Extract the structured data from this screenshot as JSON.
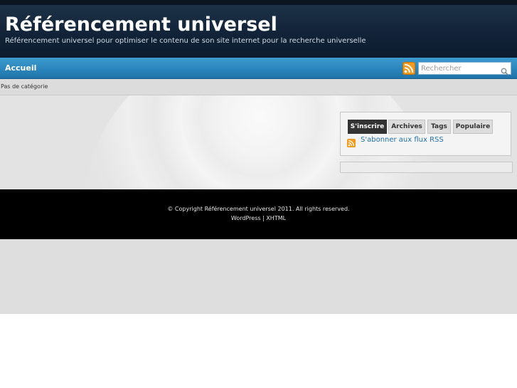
{
  "header": {
    "title": "Référencement universel",
    "description": "Référencement universel pour optimiser le contenu de son site internet pour la recherche universelle"
  },
  "nav": {
    "home_label": "Accueil",
    "rss_icon": "rss-icon",
    "search": {
      "placeholder": "Rechercher",
      "icon": "search-icon"
    }
  },
  "breadcrumb": {
    "text": "Pas de catégorie"
  },
  "sidebar": {
    "tabs": [
      {
        "label": "S'inscrire",
        "active": true
      },
      {
        "label": "Archives",
        "active": false
      },
      {
        "label": "Tags",
        "active": false
      },
      {
        "label": "Populaire",
        "active": false
      }
    ],
    "feed_link": "S'abonner aux flux RSS"
  },
  "footer": {
    "copyright": "© Copyright Référencement universel 2011. All rights reserved.",
    "link_wordpress": "WordPress",
    "separator": "|",
    "link_xhtml": "XHTML"
  },
  "colors": {
    "header_bg": "#112237",
    "nav_bg": "#2a86bd",
    "active_tab": "#333333",
    "link": "#1f6ea8",
    "rss": "#f39a1c"
  }
}
